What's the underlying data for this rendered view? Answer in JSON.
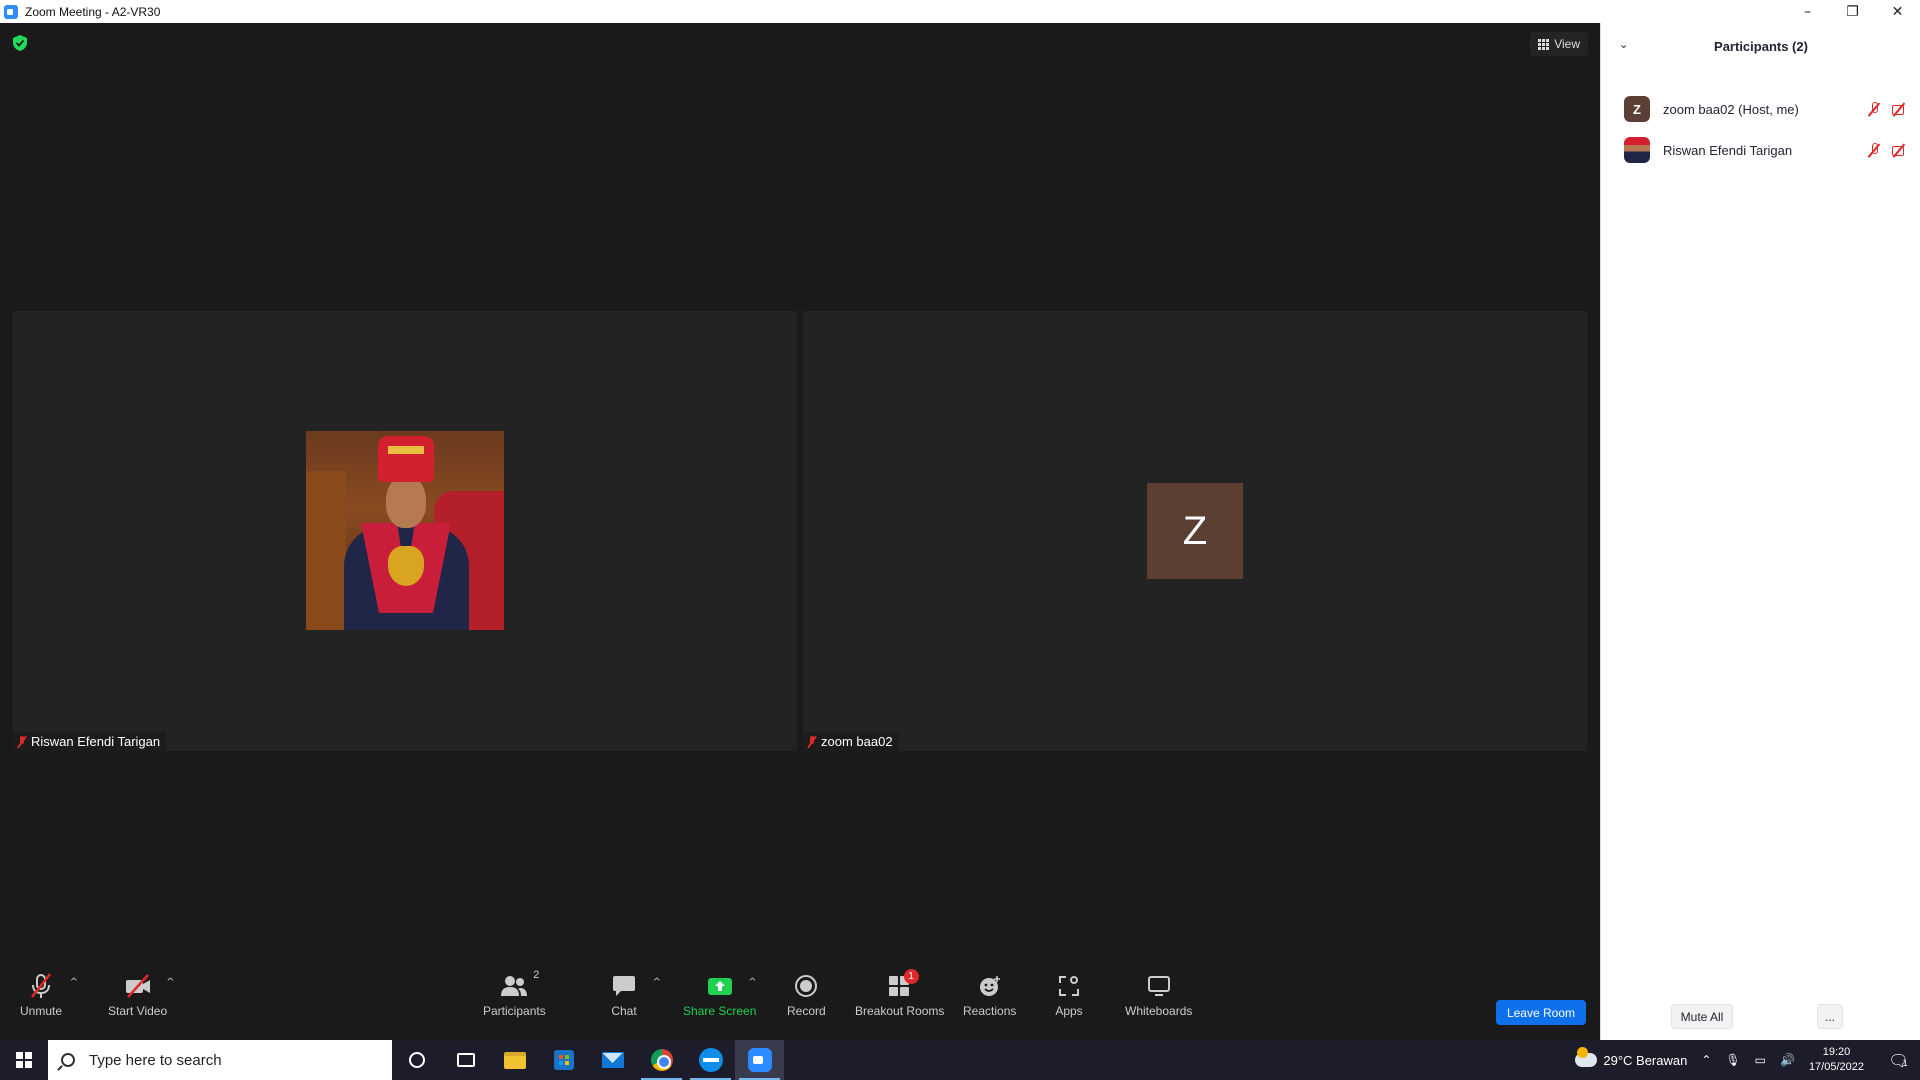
{
  "window": {
    "title": "Zoom Meeting - A2-VR30",
    "controls": [
      "–",
      "❐",
      "✕"
    ]
  },
  "meeting": {
    "view_label": "View",
    "tiles": [
      {
        "name": "Riswan Efendi Tarigan",
        "muted": true,
        "video": "profile-photo"
      },
      {
        "name": "zoom baa02",
        "muted": true,
        "avatar_letter": "Z",
        "avatar_color": "#5c3f33"
      }
    ]
  },
  "toolbar": {
    "unmute": "Unmute",
    "start_video": "Start Video",
    "participants": "Participants",
    "participants_count": "2",
    "chat": "Chat",
    "share_screen": "Share Screen",
    "record": "Record",
    "breakout_rooms": "Breakout Rooms",
    "breakout_badge": "1",
    "reactions": "Reactions",
    "apps": "Apps",
    "whiteboards": "Whiteboards",
    "leave": "Leave Room",
    "caret": "^"
  },
  "participants_panel": {
    "title": "Participants (2)",
    "collapse_icon": "chevron-down-icon",
    "participants": [
      {
        "name": "zoom baa02 (Host, me)",
        "avatar_letter": "Z",
        "mic": "muted",
        "video": "off"
      },
      {
        "name": "Riswan Efendi Tarigan",
        "avatar_letter": "",
        "mic": "muted",
        "video": "off"
      }
    ],
    "mute_all": "Mute All",
    "more": "..."
  },
  "taskbar": {
    "search_placeholder": "Type here to search",
    "weather": "29°C  Berawan",
    "time": "19:20",
    "date": "17/05/2022",
    "notification_count": "1"
  },
  "colors": {
    "accent": "#0e71eb",
    "share_green": "#1fd14f",
    "muted_red": "#e02828",
    "meeting_bg": "#1a1a1a"
  }
}
